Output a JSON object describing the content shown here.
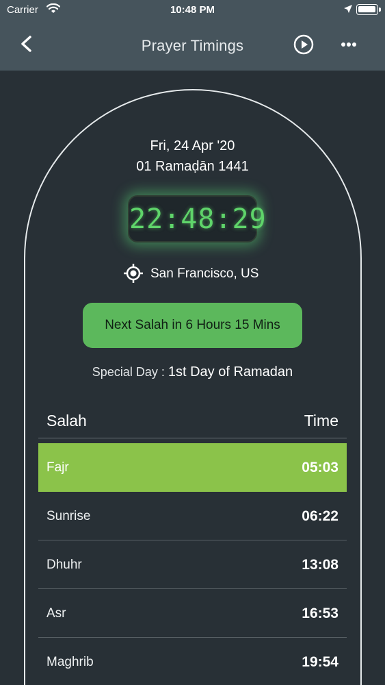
{
  "status_bar": {
    "carrier": "Carrier",
    "time": "10:48 PM",
    "icons": [
      "wifi-icon",
      "location-arrow-icon",
      "battery-charging-icon"
    ]
  },
  "nav": {
    "title": "Prayer Timings",
    "icons": [
      "chevron-left-icon",
      "play-circle-icon",
      "more-dots-icon"
    ]
  },
  "date": {
    "gregorian": "Fri, 24 Apr '20",
    "hijri": "01 Ramaḍān 1441"
  },
  "clock": {
    "time": "22:48:29",
    "color": "#5fd46a"
  },
  "location": {
    "text": "San Francisco, US",
    "icon": "location-target-icon"
  },
  "next_salah": {
    "label": "Next Salah in 6 Hours 15 Mins",
    "color": "#5cb85c"
  },
  "special_day": {
    "label": "Special Day : ",
    "value": "1st Day of Ramadan"
  },
  "table": {
    "headers": {
      "salah": "Salah",
      "time": "Time"
    },
    "active_color": "#8bc34a",
    "rows": [
      {
        "name": "Fajr",
        "time": "05:03",
        "active": true
      },
      {
        "name": "Sunrise",
        "time": "06:22",
        "active": false
      },
      {
        "name": "Dhuhr",
        "time": "13:08",
        "active": false
      },
      {
        "name": "Asr",
        "time": "16:53",
        "active": false
      },
      {
        "name": "Maghrib",
        "time": "19:54",
        "active": false
      }
    ]
  },
  "colors": {
    "background": "#283036",
    "nav_bar": "#46545c"
  }
}
